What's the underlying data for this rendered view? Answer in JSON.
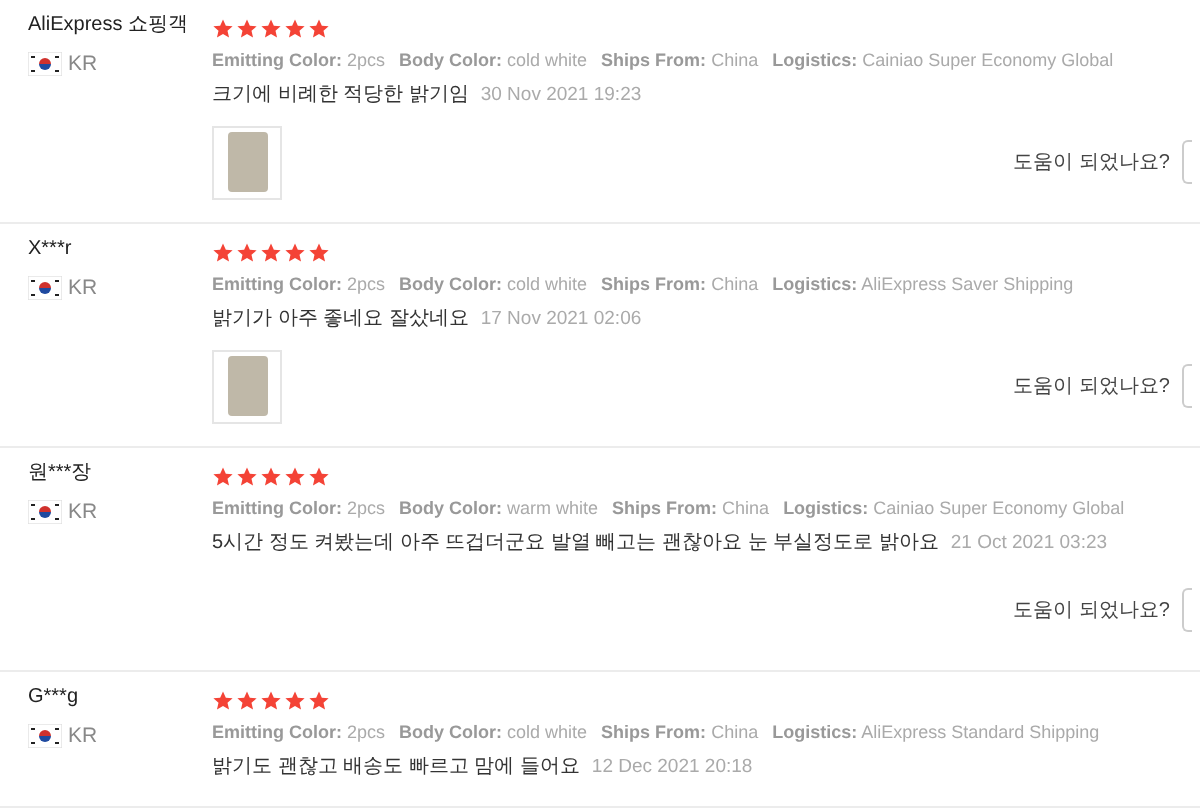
{
  "reviews": [
    {
      "name": "AliExpress 쇼핑객",
      "country": "KR",
      "stars": 5,
      "attributes": [
        {
          "label": "Emitting Color:",
          "value": "2pcs"
        },
        {
          "label": "Body Color:",
          "value": "cold white"
        },
        {
          "label": "Ships From:",
          "value": "China"
        },
        {
          "label": "Logistics:",
          "value": "Cainiao Super Economy Global"
        }
      ],
      "text": "크기에 비례한 적당한 밝기임",
      "date": "30 Nov 2021 19:23",
      "photo": true,
      "helpful": "도움이 되었나요?"
    },
    {
      "name": "X***r",
      "country": "KR",
      "stars": 5,
      "attributes": [
        {
          "label": "Emitting Color:",
          "value": "2pcs"
        },
        {
          "label": "Body Color:",
          "value": "cold white"
        },
        {
          "label": "Ships From:",
          "value": "China"
        },
        {
          "label": "Logistics:",
          "value": "AliExpress Saver Shipping"
        }
      ],
      "text": "밝기가 아주 좋네요 잘샀네요",
      "date": "17 Nov 2021 02:06",
      "photo": true,
      "helpful": "도움이 되었나요?"
    },
    {
      "name": "원***장",
      "country": "KR",
      "stars": 5,
      "attributes": [
        {
          "label": "Emitting Color:",
          "value": "2pcs"
        },
        {
          "label": "Body Color:",
          "value": "warm white"
        },
        {
          "label": "Ships From:",
          "value": "China"
        },
        {
          "label": "Logistics:",
          "value": "Cainiao Super Economy Global"
        }
      ],
      "text": "5시간 정도 켜봤는데 아주 뜨겁더군요 발열 빼고는 괜찮아요 눈 부실정도로 밝아요",
      "date": "21 Oct 2021 03:23",
      "photo": false,
      "helpful": "도움이 되었나요?"
    },
    {
      "name": "G***g",
      "country": "KR",
      "stars": 5,
      "attributes": [
        {
          "label": "Emitting Color:",
          "value": "2pcs"
        },
        {
          "label": "Body Color:",
          "value": "cold white"
        },
        {
          "label": "Ships From:",
          "value": "China"
        },
        {
          "label": "Logistics:",
          "value": "AliExpress Standard Shipping"
        }
      ],
      "text": "밝기도 괜찮고 배송도 빠르고 맘에 들어요",
      "date": "12 Dec 2021 20:18",
      "photo": false
    }
  ]
}
